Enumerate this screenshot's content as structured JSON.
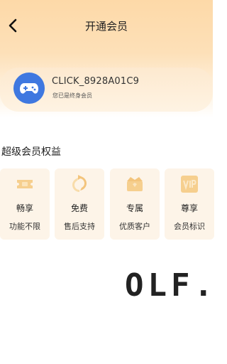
{
  "header": {
    "title": "开通会员",
    "back_icon": "back-arrow-icon"
  },
  "member": {
    "avatar_icon": "gamepad-icon",
    "avatar_color": "#3f78e0",
    "name": "CLICK_8928A01C9",
    "status": "您已是终身会员"
  },
  "benefits_section": {
    "title": "超级会员权益",
    "items": [
      {
        "icon": "ticket-icon",
        "title": "畅享",
        "subtitle": "功能不限"
      },
      {
        "icon": "refresh-icon",
        "title": "免费",
        "subtitle": "售后支持"
      },
      {
        "icon": "crown-box-icon",
        "title": "专属",
        "subtitle": "优质客户"
      },
      {
        "icon": "vip-badge-icon",
        "title": "尊享",
        "subtitle": "会员标识"
      }
    ]
  },
  "watermark": {
    "text": "OLF."
  },
  "colors": {
    "accent": "#f0b860",
    "card_bg": "#fdf4e8",
    "header_gradient_top": "#fdd9a8"
  }
}
